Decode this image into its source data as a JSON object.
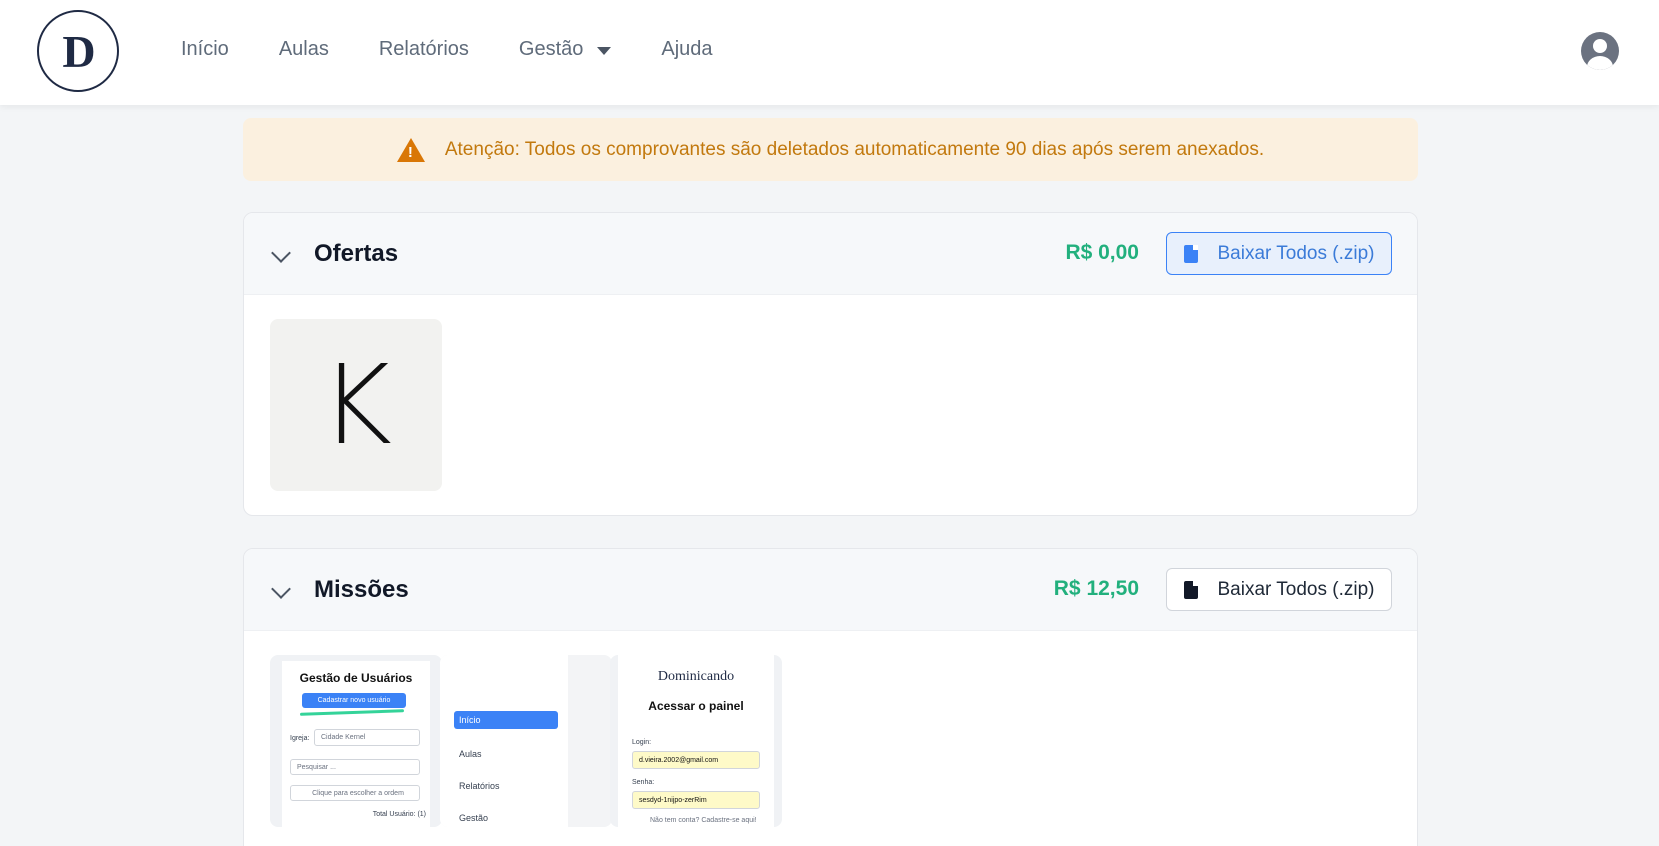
{
  "header": {
    "logo_alt": "D",
    "nav": [
      {
        "label": "Início"
      },
      {
        "label": "Aulas"
      },
      {
        "label": "Relatórios"
      },
      {
        "label": "Gestão"
      },
      {
        "label": "Ajuda"
      }
    ],
    "icons": {
      "user": "user-circle-icon",
      "dropdown": "caret-down-icon"
    }
  },
  "alert": {
    "text": "Atenção: Todos os comprovantes são deletados automaticamente 90 dias após serem anexados.",
    "color": "#c2790e",
    "icon": "warning-icon"
  },
  "sections": {
    "ofertas": {
      "title": "Ofertas",
      "amount": "R$ 0,00",
      "download_label": "Baixar Todos (.zip)",
      "thumb_letter": "K"
    },
    "missoes": {
      "title": "Missões",
      "amount": "R$ 12,50",
      "download_label": "Baixar Todos (.zip)",
      "thumb1": {
        "title": "Gestão de Usuários",
        "button": "Cadastrar novo usuário",
        "igreja_label": "Igreja:",
        "igreja_value": "Cidade Kernel",
        "search_placeholder": "Pesquisar ...",
        "order_label": "Clique para escolher a ordem",
        "total": "Total Usuário: (1)"
      },
      "thumb2": {
        "items": [
          "Início",
          "Aulas",
          "Relatórios",
          "Gestão"
        ]
      },
      "thumb3": {
        "logo": "Dominicando",
        "title": "Acessar o painel",
        "login_label": "Login:",
        "login_value": "d.vieira.2002@gmail.com",
        "senha_label": "Senha:",
        "senha_value": "sesdyd-1nijpo-zerRim",
        "footer": "Não tem conta? Cadastre-se aqui!"
      }
    }
  },
  "colors": {
    "amount_green": "#22b07d",
    "accent_blue": "#3b82f6",
    "alert_bg": "#fbf0df"
  }
}
